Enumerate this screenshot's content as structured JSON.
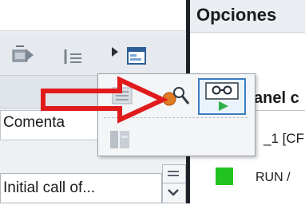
{
  "colors": {
    "divider": "#1e2228",
    "status_run": "#21c321",
    "arrow": "#e11b1b",
    "highlight_border": "#3a7dc0"
  },
  "left": {
    "comment_header": "Comenta",
    "value_field": "Initial call of..."
  },
  "right": {
    "title": "Opciones",
    "panel_label": "anel c",
    "cpu_label": "_1 [CF",
    "status_label": "RUN /"
  },
  "toolbar_icons": [
    "download-to-device-icon",
    "indent-list-icon",
    "expand-arrow-icon",
    "properties-window-icon"
  ],
  "popup_items": [
    "list-icon",
    "search-magnifier-icon",
    "monitor-glasses-icon",
    "disabled-item-icon"
  ],
  "annotation": {
    "arrow": "red-outline-arrow"
  }
}
